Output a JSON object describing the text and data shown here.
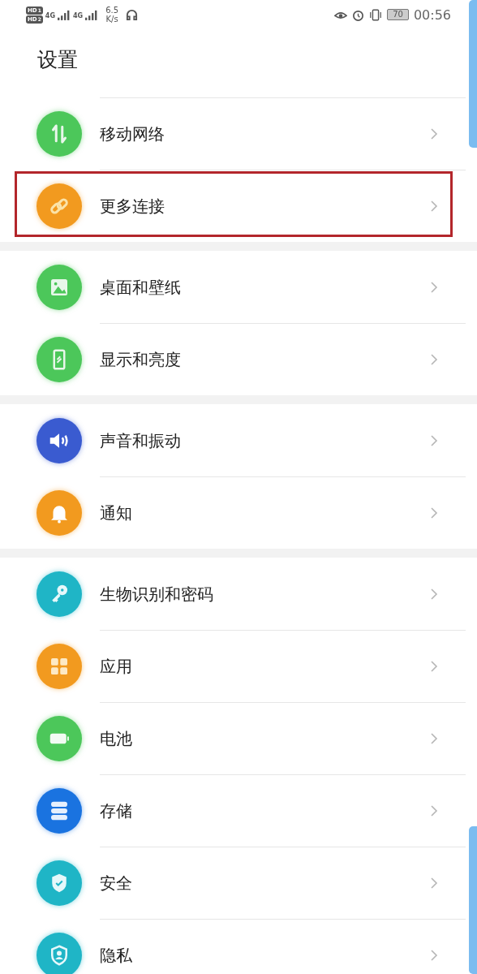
{
  "status_bar": {
    "sims": [
      {
        "badge": "HD",
        "slot": "1",
        "network": "4G"
      },
      {
        "badge": "HD",
        "slot": "2",
        "network": "4G"
      }
    ],
    "speed": "6.5",
    "speed_unit": "K/s",
    "battery": "70",
    "time": "00:56"
  },
  "title": "设置",
  "groups": [
    {
      "items": [
        {
          "label": "移动网络",
          "kind": "arrows",
          "color": "#4cc75a",
          "highlighted": false
        },
        {
          "label": "更多连接",
          "kind": "link",
          "color": "#f29a1f",
          "highlighted": true
        }
      ]
    },
    {
      "items": [
        {
          "label": "桌面和壁纸",
          "kind": "image",
          "color": "#4cc75a",
          "highlighted": false
        },
        {
          "label": "显示和亮度",
          "kind": "display",
          "color": "#4cc75a",
          "highlighted": false
        }
      ]
    },
    {
      "items": [
        {
          "label": "声音和振动",
          "kind": "sound",
          "color": "#3a5bd0",
          "highlighted": false
        },
        {
          "label": "通知",
          "kind": "bell",
          "color": "#f29a1f",
          "highlighted": false
        }
      ]
    },
    {
      "items": [
        {
          "label": "生物识别和密码",
          "kind": "key",
          "color": "#1fb5c6",
          "highlighted": false
        },
        {
          "label": "应用",
          "kind": "apps",
          "color": "#f29a1f",
          "highlighted": false
        },
        {
          "label": "电池",
          "kind": "battery",
          "color": "#4cc75a",
          "highlighted": false
        },
        {
          "label": "存储",
          "kind": "storage",
          "color": "#1a73e0",
          "highlighted": false
        },
        {
          "label": "安全",
          "kind": "shield",
          "color": "#1fb5c6",
          "highlighted": false
        },
        {
          "label": "隐私",
          "kind": "privacy",
          "color": "#1fb5c6",
          "highlighted": false
        }
      ]
    }
  ]
}
